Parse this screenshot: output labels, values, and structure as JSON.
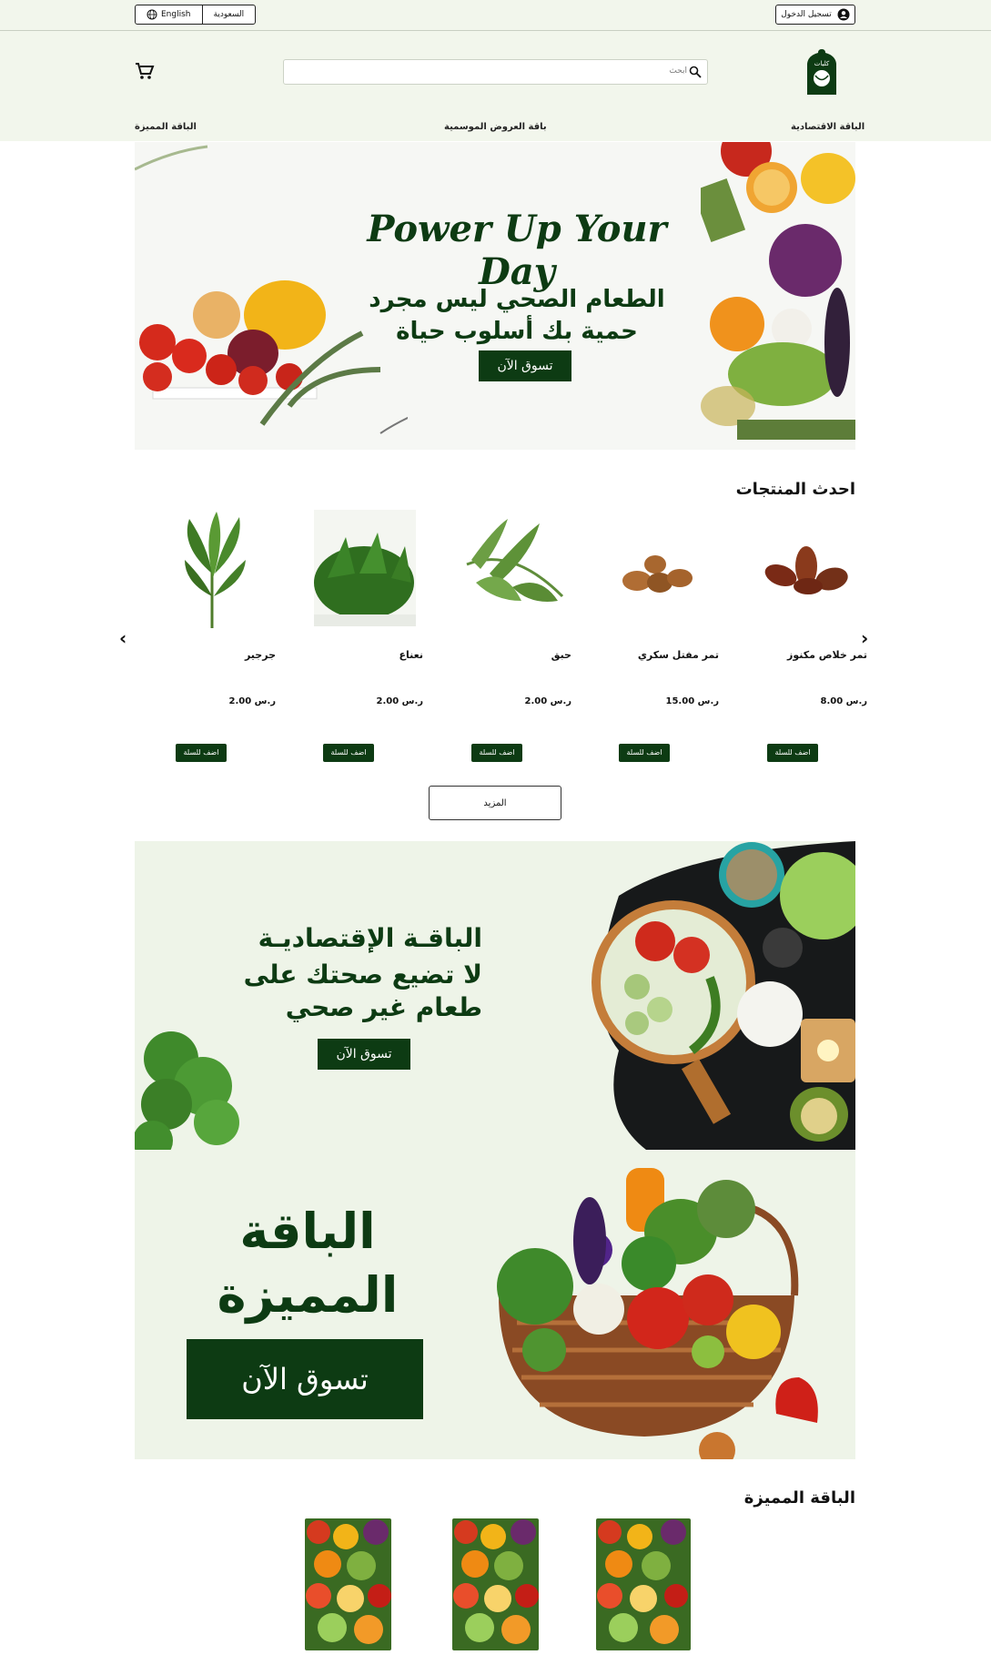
{
  "topbar": {
    "lang_english": "English",
    "lang_country": "السعودية",
    "login_label": "تسجيل الدخول"
  },
  "header": {
    "search_placeholder": "ابحث",
    "logo_text": "كليات"
  },
  "nav": {
    "left": "الباقة المميزة",
    "center": "باقة العروض الموسمية",
    "right": "الباقة الاقتصادية"
  },
  "hero": {
    "english_line": "Power Up Your Day",
    "arabic_line1": "الطعام الصحي ليس مجرد",
    "arabic_line2": "حمية بك أسلوب حياة",
    "cta": "تسوق الآن"
  },
  "latest": {
    "title": "احدث المنتجات",
    "products": [
      {
        "name": "تمر خلاص مكنوز",
        "price": "8.00 ر.س",
        "add": "اضف للسلة"
      },
      {
        "name": "تمر مفتل سكري",
        "price": "15.00 ر.س",
        "add": "اضف للسلة"
      },
      {
        "name": "حبق",
        "price": "2.00 ر.س",
        "add": "اضف للسلة"
      },
      {
        "name": "نعناع",
        "price": "2.00 ر.س",
        "add": "اضف للسلة"
      },
      {
        "name": "جرجير",
        "price": "2.00 ر.س",
        "add": "اضف للسلة"
      }
    ],
    "more_label": "المزيد"
  },
  "economy_banner": {
    "line1": "الباقـة الإقتصاديـة",
    "line2": "لا تضيع صحتك على",
    "line3": "طعام غير صحي",
    "cta": "تسوق الآن"
  },
  "premium_banner": {
    "line1": "الباقة",
    "line2": "المميزة",
    "cta": "تسوق الآن"
  },
  "premium_section": {
    "title": "الباقة المميزة"
  },
  "colors": {
    "brand_green": "#0d3b13",
    "header_bg": "#f2f6ec"
  }
}
